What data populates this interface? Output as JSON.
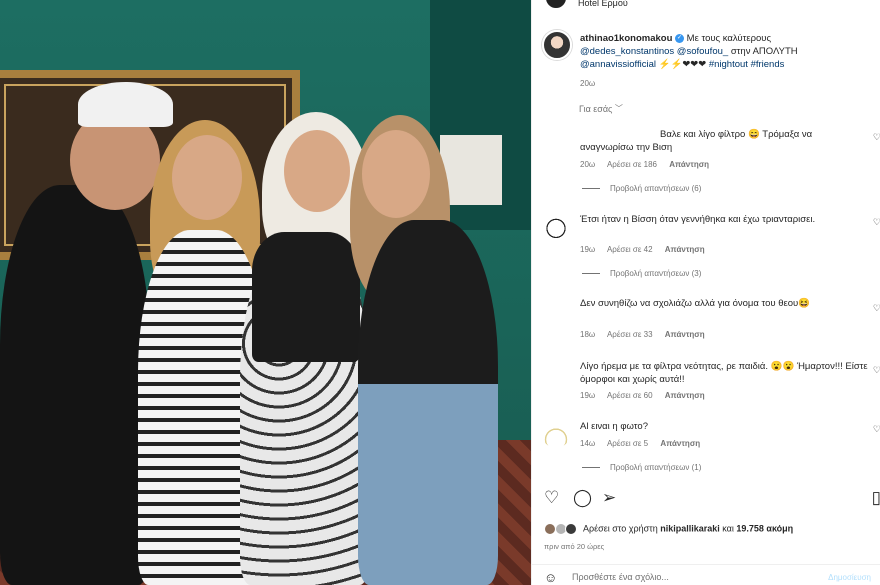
{
  "location": {
    "text": "Hotel Ερμού"
  },
  "caption": {
    "username": "athinao1konomakou",
    "text": "Με τους καλύτερους",
    "mention1": "@dedes_konstantinos",
    "mention2": "@sofoufou_",
    "text2": "στην ΑΠΟΛΥΤΗ",
    "mention3": "@annavissiofficial",
    "emoji": "⚡⚡❤❤❤",
    "tag1": "#nightout",
    "tag2": "#friends",
    "time": "20ω"
  },
  "for_you": {
    "label": "Για εσάς",
    "chevron": "﹀"
  },
  "comments": [
    {
      "text": "Βαλε και λίγο φίλτρο 😄 Τρόμαξα να αναγνωρίσω την Βιση",
      "time": "20ω",
      "likes": "Αρέσει σε 186",
      "reply": "Απάντηση",
      "view_replies": "Προβολή απαντήσεων (6)"
    },
    {
      "text": "Έτσι ήταν η Βίσση όταν γεννήθηκα και έχω τριανταρισει.",
      "time": "19ω",
      "likes": "Αρέσει σε 42",
      "reply": "Απάντηση",
      "view_replies": "Προβολή απαντήσεων (3)"
    },
    {
      "text": "Δεν συνηθίζω να σχολιάζω αλλά για όνομα του θεου😆",
      "time": "18ω",
      "likes": "Αρέσει σε 33",
      "reply": "Απάντηση"
    },
    {
      "text": "Λίγο ήρεμα με τα φίλτρα νεότητας, ρε παιδιά. 😮😮 Ήμαρτον!!! Είστε όμορφοι και χωρίς αυτά!!",
      "time": "19ω",
      "likes": "Αρέσει σε 60",
      "reply": "Απάντηση"
    },
    {
      "text": "Αl ειναι η φωτο?",
      "time": "14ω",
      "likes": "Αρέσει σε 5",
      "reply": "Απάντηση",
      "view_replies": "Προβολή απαντήσεων (1)"
    }
  ],
  "likes": {
    "prefix": "Αρέσει στο χρήστη",
    "user": "nikipallikaraki",
    "connector": "και",
    "count": "19.758 ακόμη"
  },
  "ago": "πριν από 20 ώρες",
  "add_comment": {
    "placeholder": "Προσθέστε ένα σχόλιο...",
    "post": "Δημοσίευση"
  },
  "icons": {
    "heart": "heart-icon",
    "comment": "comment-icon",
    "share": "share-icon",
    "bookmark": "bookmark-icon",
    "emoji": "emoji-icon"
  },
  "colors": {
    "link": "#00376b",
    "verified": "#3897f0",
    "wall": "#1a6458"
  }
}
